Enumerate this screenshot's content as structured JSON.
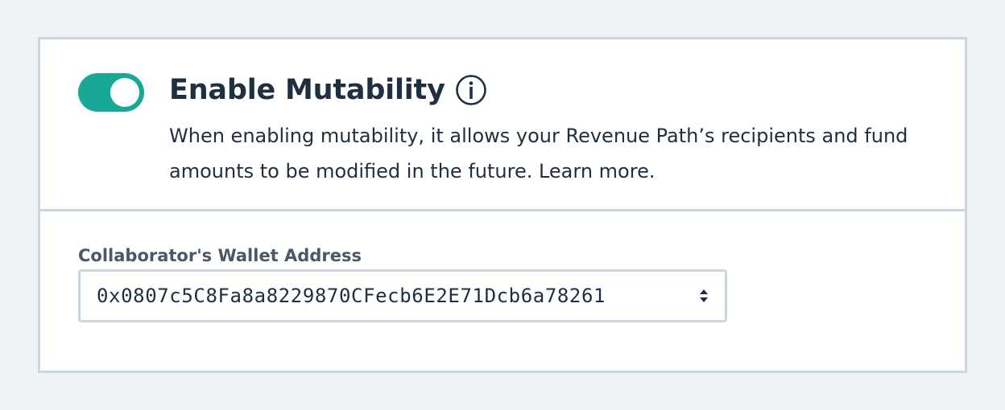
{
  "mutability": {
    "enabled": true,
    "title": "Enable Mutability",
    "info_icon": "info-circle-icon",
    "description": "When enabling mutability, it allows your Revenue Path’s recipients and fund amounts to be modified in the future. Learn more."
  },
  "wallet": {
    "label": "Collaborator's Wallet Address",
    "selected": "0x0807c5C8Fa8a8229870CFecb6E2E71Dcb6a78261",
    "arrow_icon": "select-arrows-icon"
  },
  "colors": {
    "accent": "#17a995",
    "text": "#1f2f40",
    "border": "#cbd5df",
    "background": "#f0f3f6"
  }
}
